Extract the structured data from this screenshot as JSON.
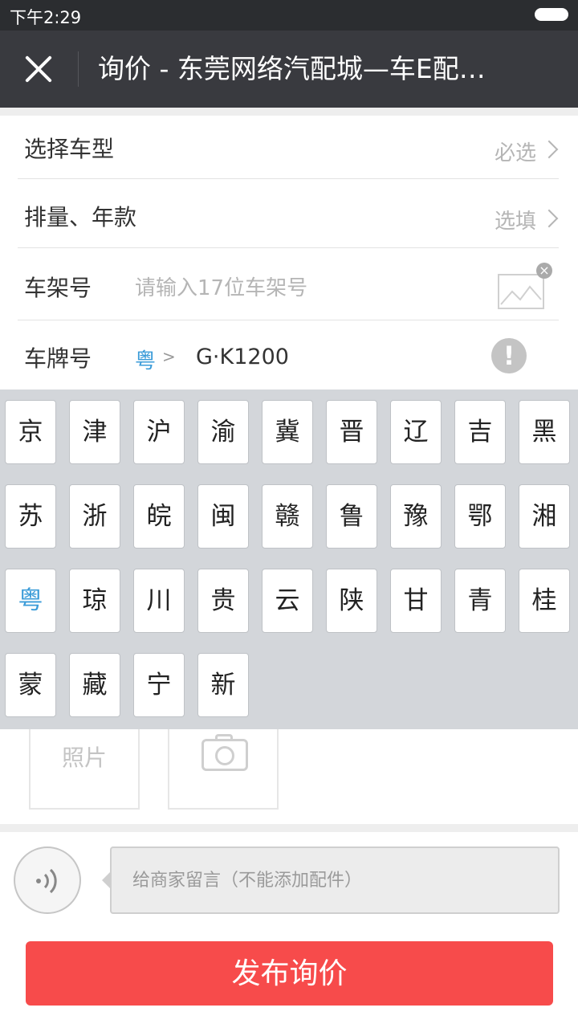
{
  "status_bar": {
    "time": "下午2:29"
  },
  "header": {
    "title": "询价 - 东莞网络汽配城—车E配…"
  },
  "form": {
    "vehicle_model": {
      "label": "选择车型",
      "hint": "必选"
    },
    "displacement_year": {
      "label": "排量、年款",
      "hint": "选填"
    },
    "vin": {
      "label": "车架号",
      "placeholder": "请输入17位车架号",
      "image_close": "×"
    },
    "plate": {
      "label": "车牌号",
      "province": "粤",
      "arrow": ">",
      "value": "G·K1200",
      "warning": "!"
    }
  },
  "keyboard": {
    "keys": [
      "京",
      "津",
      "沪",
      "渝",
      "冀",
      "晋",
      "辽",
      "吉",
      "黑",
      "苏",
      "浙",
      "皖",
      "闽",
      "赣",
      "鲁",
      "豫",
      "鄂",
      "湘",
      "粤",
      "琼",
      "川",
      "贵",
      "云",
      "陕",
      "甘",
      "青",
      "桂",
      "蒙",
      "藏",
      "宁",
      "新"
    ],
    "active_key": "粤"
  },
  "photo": {
    "label": "照片"
  },
  "message": {
    "placeholder": "给商家留言（不能添加配件）"
  },
  "publish_button": "发布询价",
  "colors": {
    "accent_blue": "#3a9bd8",
    "publish_red": "#f74b4b",
    "title_bar": "#393a3f"
  },
  "icons": {
    "close": "close-icon",
    "image": "image-icon",
    "warning": "warning-icon",
    "camera": "camera-icon",
    "voice": "voice-icon"
  }
}
